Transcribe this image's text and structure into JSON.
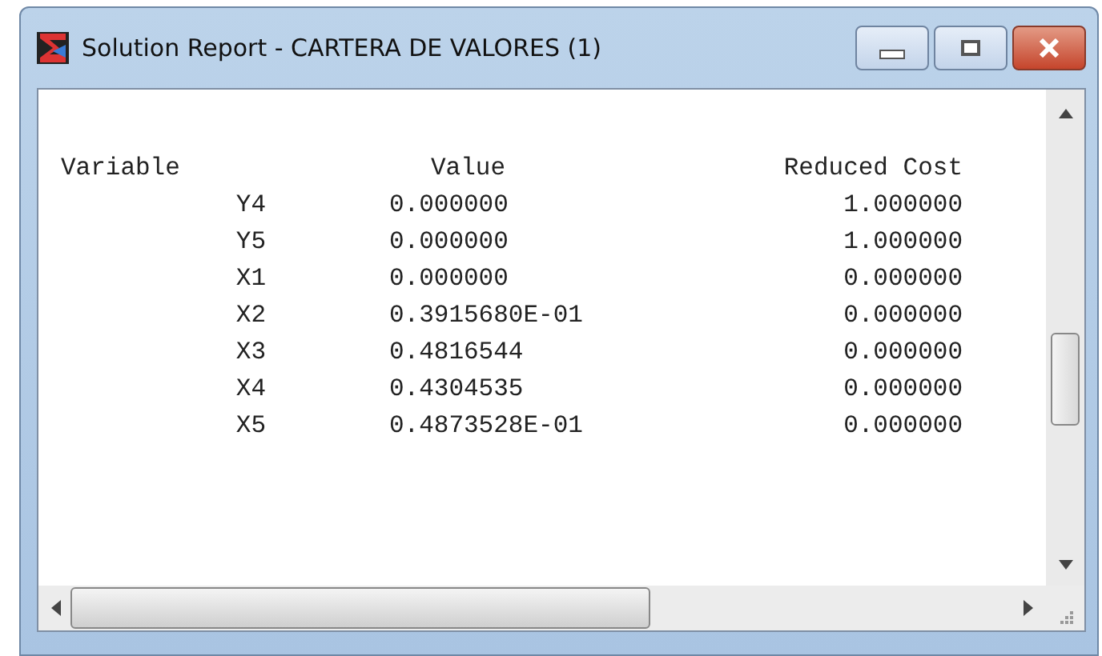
{
  "window": {
    "title": "Solution Report - CARTERA DE VALORES (1)"
  },
  "report": {
    "columns": [
      "Variable",
      "Value",
      "Reduced Cost"
    ],
    "rows": [
      [
        "Y4",
        "0.000000",
        "1.000000"
      ],
      [
        "Y5",
        "0.000000",
        "1.000000"
      ],
      [
        "X1",
        "0.000000",
        "0.000000"
      ],
      [
        "X2",
        "0.3915680E-01",
        "0.000000"
      ],
      [
        "X3",
        "0.4816544",
        "0.000000"
      ],
      [
        "X4",
        "0.4304535",
        "0.000000"
      ],
      [
        "X5",
        "0.4873528E-01",
        "0.000000"
      ]
    ]
  }
}
